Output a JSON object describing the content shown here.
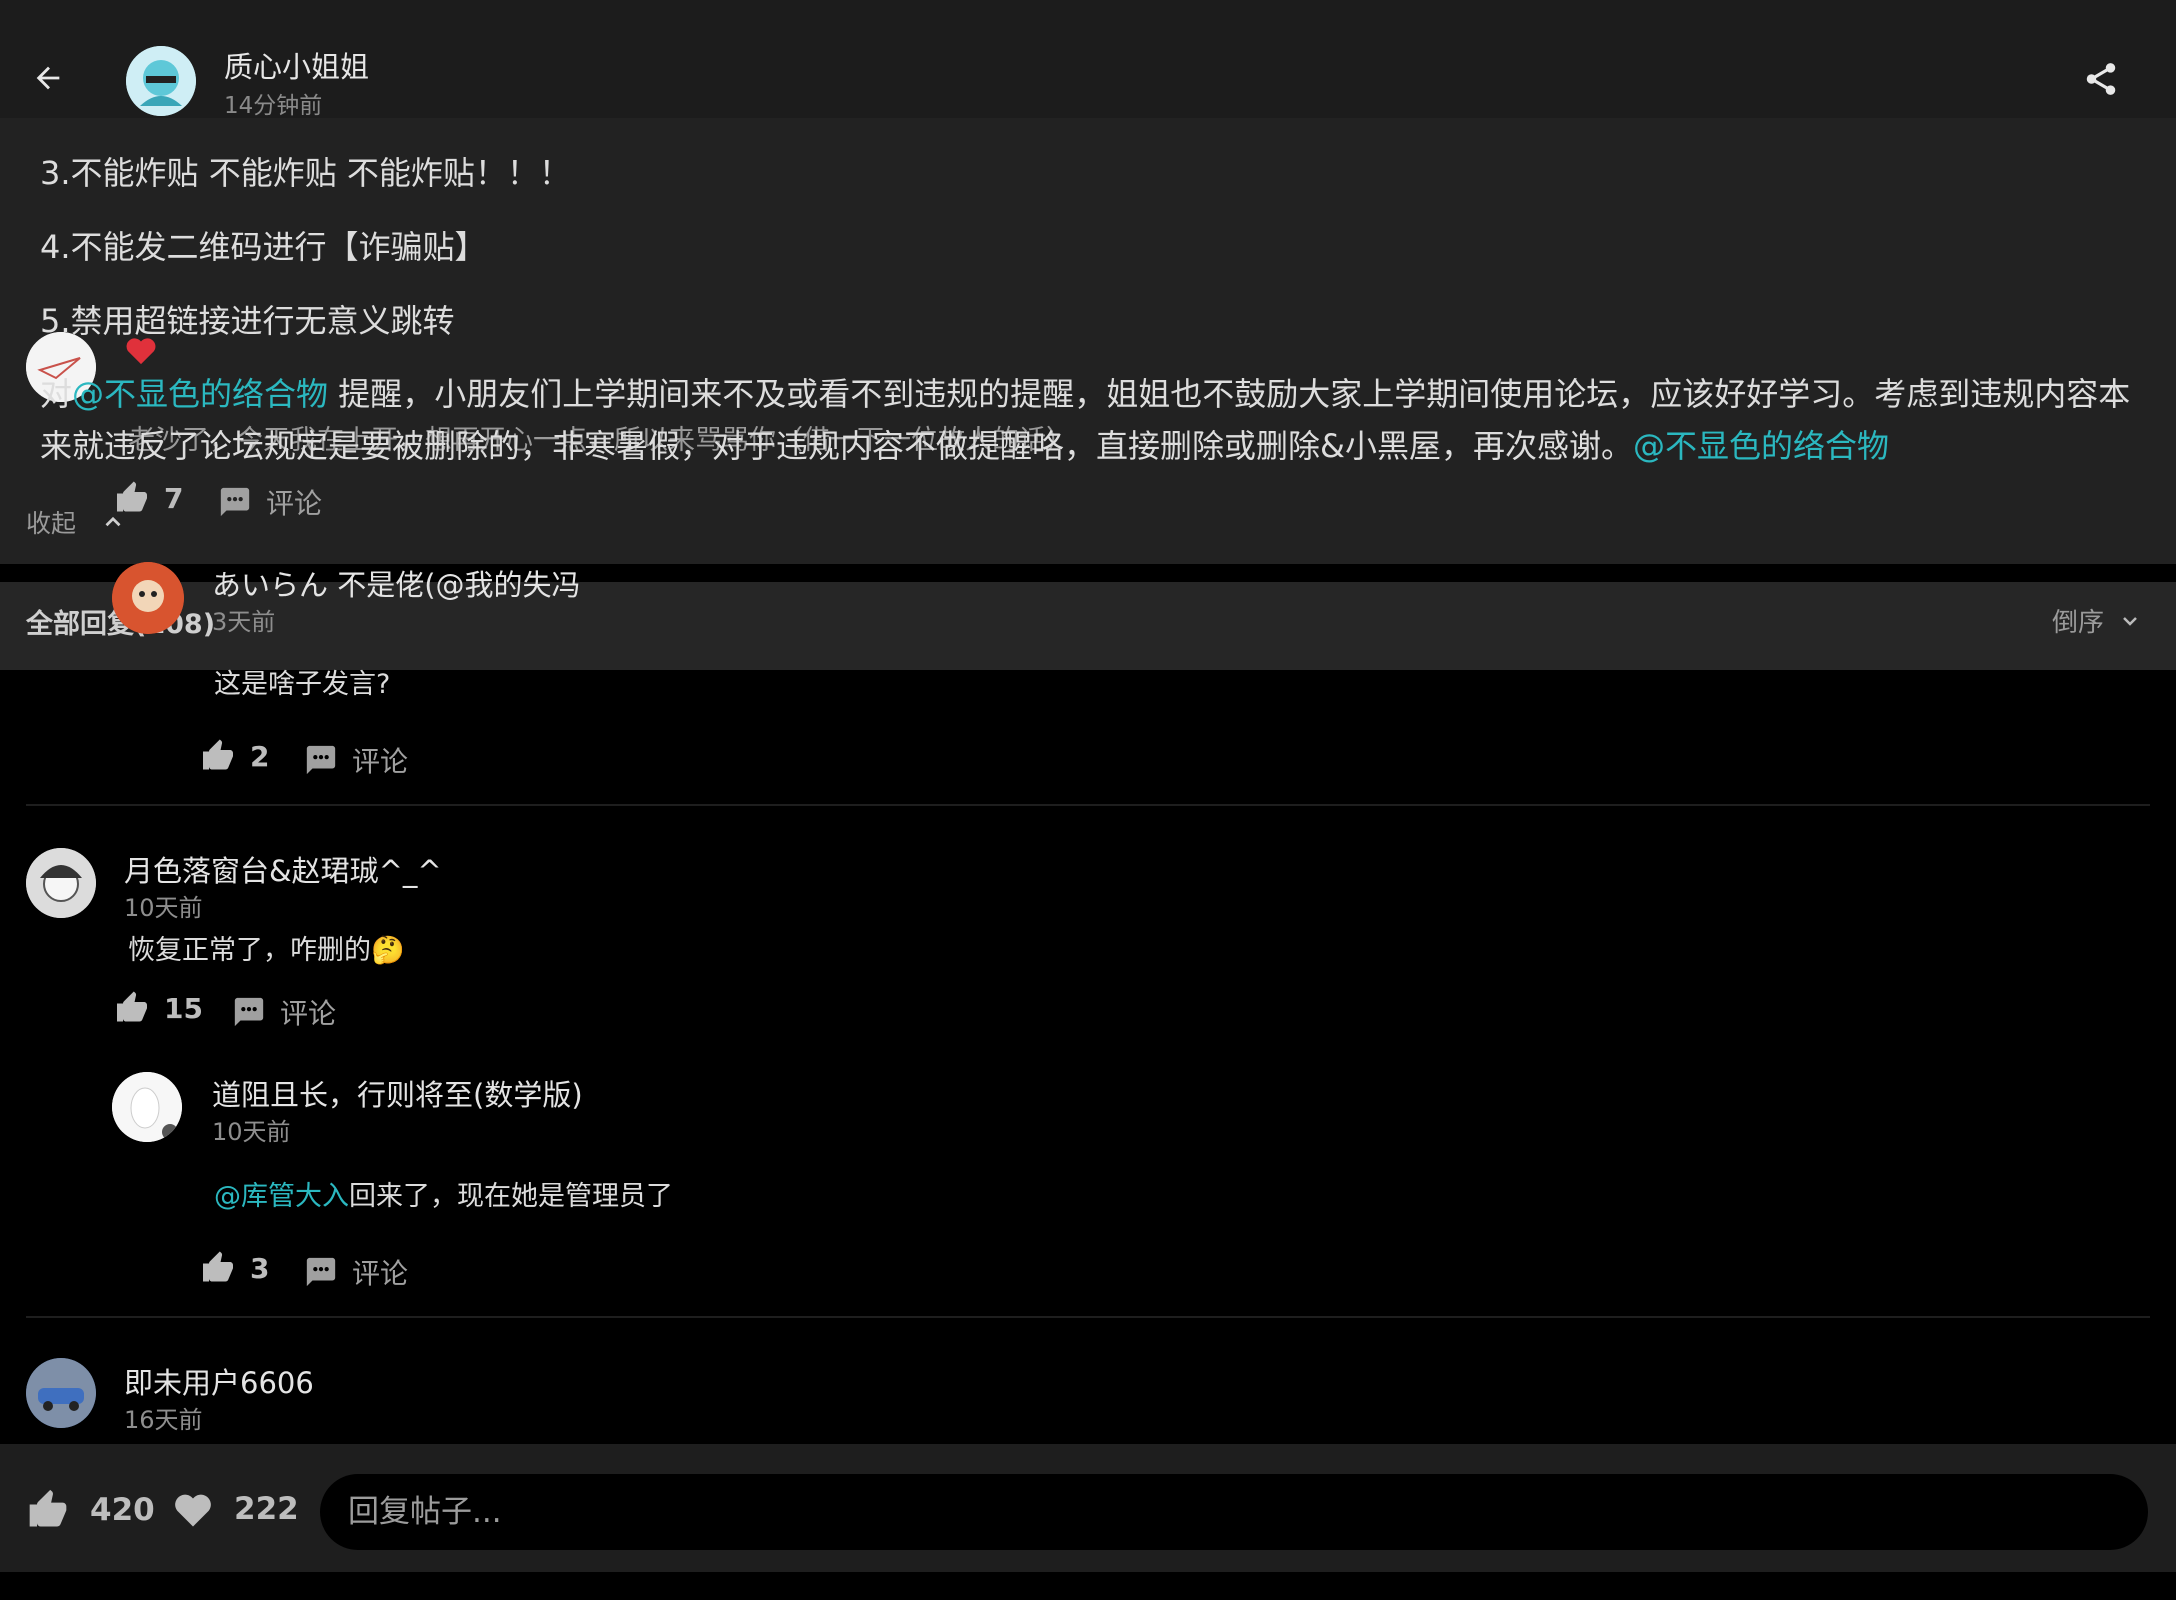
{
  "header": {
    "author": "质心小姐姐",
    "time": "14分钟前"
  },
  "post": {
    "lines": [
      "3.不能炸贴 不能炸贴 不能炸贴！！！",
      "4.不能发二维码进行【诈骗贴】",
      "5.禁用超链接进行无意义跳转"
    ],
    "comment_line1_prefix": "对",
    "comment_mention1": "@不显色的络合物",
    "comment_line1_rest": " 提醒，小朋友们上学期间来不及或看不到违规的提醒，姐姐也不鼓励大家上学期间使用论坛，应该好好学习。考虑到违规内容本",
    "comment_line2": "来就违反了论坛规定是要被删除的，非寒暑假，对于违规内容不做提醒咯，直接删除或删除&小黑屋，再次感谢。",
    "comment_mention2": "@不显色的络合物",
    "ghost_line": "老沙了，今天我在上开，想再开心一点，所以来骂骂你（借一下一位故人的话）",
    "likes": "7",
    "comment_label": "评论",
    "collapse_label": "收起"
  },
  "replies_bar": {
    "all_label": "全部回复(108)",
    "order_label": "倒序"
  },
  "replies": [
    {
      "name": "あいらん 不是佬(@我的失冯",
      "time": "3天前",
      "text": "这是啥子发言?",
      "likes": "2",
      "comment_label": "评论"
    },
    {
      "name": "月色落窗台&赵珺珹^_^",
      "time": "10天前",
      "text": "恢复正常了，咋删的🤔",
      "likes": "15",
      "comment_label": "评论",
      "sub": {
        "name": "道阻且长，行则将至(数学版)",
        "time": "10天前",
        "mention": "@库管大入",
        "text": "回来了，现在她是管理员了",
        "likes": "3",
        "comment_label": "评论"
      }
    },
    {
      "name": "即未用户6606",
      "time": "16天前"
    }
  ],
  "bottom": {
    "likes": "420",
    "hearts": "222",
    "reply_placeholder": "回复帖子..."
  },
  "colors": {
    "accent": "#2bb8c0",
    "heart": "#e0313b",
    "background": "#000000",
    "panel": "#222222"
  }
}
